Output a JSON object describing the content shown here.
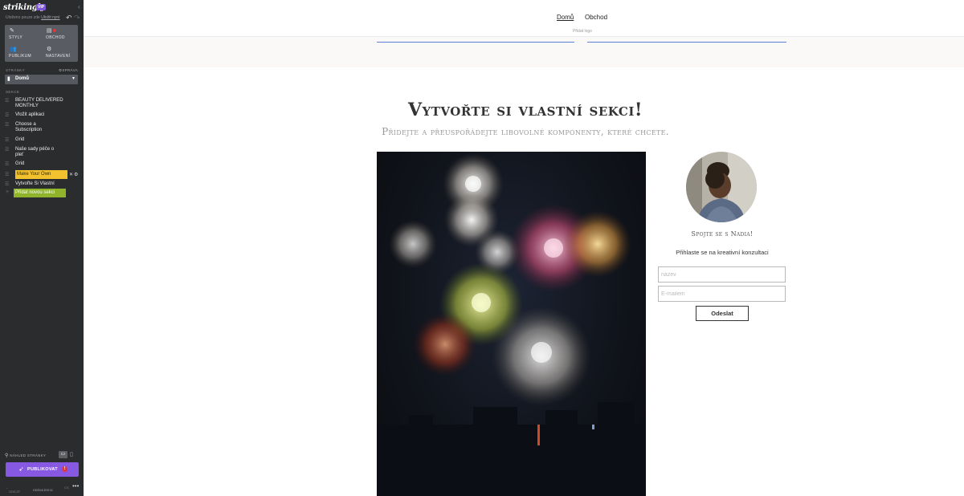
{
  "app": {
    "logo": "strikingly",
    "badge": "VIP",
    "saved_text": "Uloženo pouze zde",
    "saved_link": "Uložit nyní"
  },
  "nav": {
    "styles": "STYLY",
    "store": "OBCHOD",
    "audience": "PUBLIKUM",
    "settings": "NASTAVENÍ"
  },
  "pages": {
    "label": "STRÁNKY",
    "manage": "SPRÁVA",
    "current": "Domů"
  },
  "sections": {
    "label": "SEKCE",
    "items": [
      {
        "label": "BEAUTY DELIVERED MONTHLY"
      },
      {
        "label": "Vložit aplikaci"
      },
      {
        "label": "Choose a Subscription"
      },
      {
        "label": "Grid"
      },
      {
        "label": "Naše sady péče o pleť"
      },
      {
        "label": "Grid"
      },
      {
        "label": "Make Your Own"
      },
      {
        "label": "Vytvořte Si Vlastní"
      }
    ],
    "add": "Přidat novou sekci"
  },
  "footer": {
    "preview": "NÁHLED STRÁNKY",
    "publish": "PUBLIKOVAT",
    "publish_badge": "!",
    "exit": "ODEJÍT",
    "feedback_1": "UDĚLEJTE SI",
    "feedback_2": "PROHLÍDKU",
    "lang": "CS"
  },
  "site": {
    "nav_home": "Domů",
    "nav_store": "Obchod",
    "logo_placeholder": "Přidat logo",
    "title": "Vytvořte si vlastní sekci!",
    "subtitle": "Přidejte a přeuspořádejte libovolné komponenty, které chcete.",
    "contact": "Spojte se s Nadia!",
    "form_title": "Přihlaste se na kreativní konzultaci",
    "name_placeholder": "název",
    "email_placeholder": "E-mailem",
    "submit": "Odeslat"
  },
  "colors": {
    "sidebar_bg": "#2b2c2e",
    "highlight": "#f2c12e",
    "add_button": "#8fb42b",
    "publish": "#8759e3",
    "accent_line": "#5b7fd6"
  }
}
